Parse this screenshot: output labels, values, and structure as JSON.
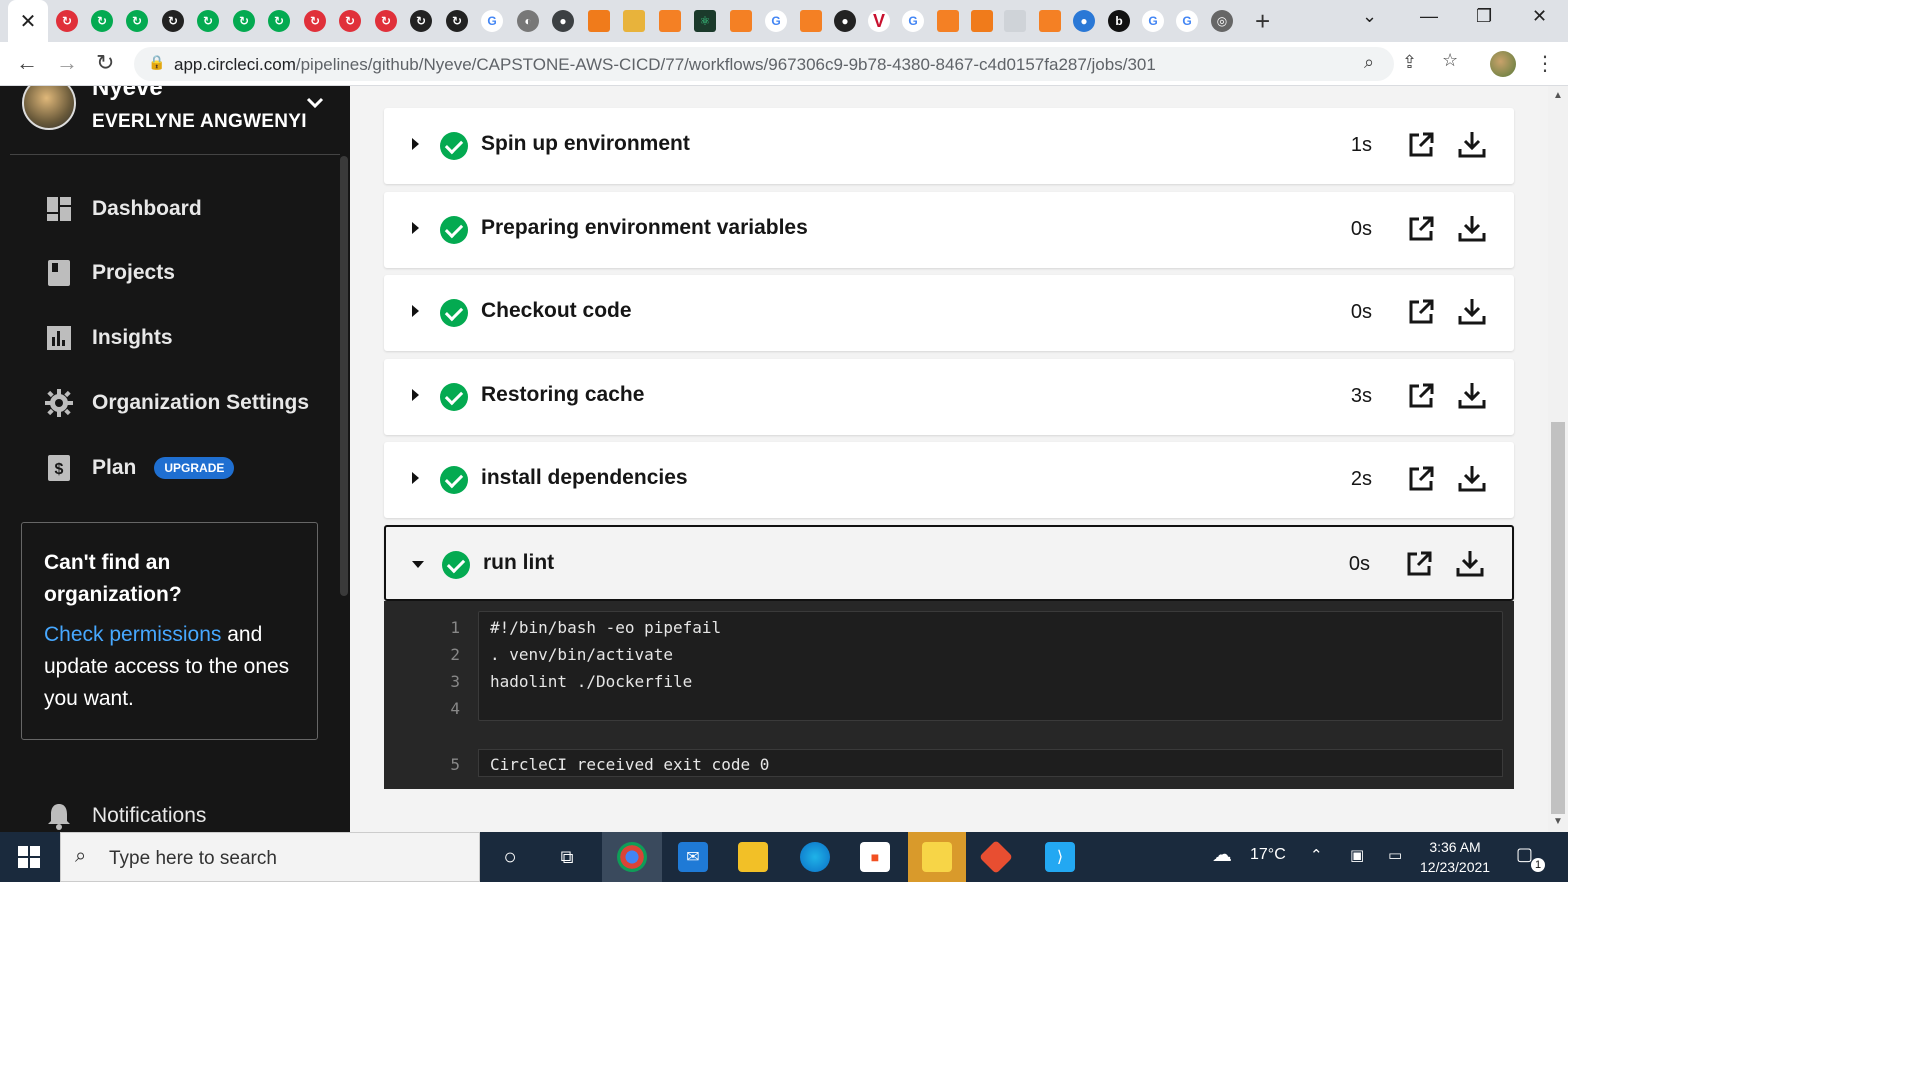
{
  "browser": {
    "url_host": "app.circleci.com",
    "url_path": "/pipelines/github/Nyeve/CAPSTONE-AWS-CICD/77/workflows/967306c9-9b78-4380-8467-c4d0157fa287/jobs/301",
    "tab_close": "✕",
    "new_tab": "+"
  },
  "sidebar": {
    "org_name": "Nyeve",
    "user_name": "EVERLYNE ANGWENYI",
    "nav": [
      {
        "label": "Dashboard",
        "icon": "dashboard-icon"
      },
      {
        "label": "Projects",
        "icon": "projects-icon"
      },
      {
        "label": "Insights",
        "icon": "insights-icon"
      },
      {
        "label": "Organization Settings",
        "icon": "gear-icon"
      },
      {
        "label": "Plan",
        "icon": "dollar-icon"
      }
    ],
    "upgrade_badge": "UPGRADE",
    "org_box": {
      "heading": "Can't find an organization?",
      "link": "Check permissions",
      "text": " and update access to the ones you want."
    },
    "notifications": "Notifications"
  },
  "steps": [
    {
      "name": "Spin up environment",
      "duration": "1s"
    },
    {
      "name": "Preparing environment variables",
      "duration": "0s"
    },
    {
      "name": "Checkout code",
      "duration": "0s"
    },
    {
      "name": "Restoring cache",
      "duration": "3s"
    },
    {
      "name": "install dependencies",
      "duration": "2s"
    },
    {
      "name": "run lint",
      "duration": "0s"
    }
  ],
  "output": {
    "lines": [
      {
        "no": "1",
        "text": "#!/bin/bash -eo pipefail"
      },
      {
        "no": "2",
        "text": ". venv/bin/activate"
      },
      {
        "no": "3",
        "text": "hadolint ./Dockerfile"
      },
      {
        "no": "4",
        "text": ""
      }
    ],
    "exit_line": {
      "no": "5",
      "text": "CircleCI received exit code 0"
    }
  },
  "taskbar": {
    "search_placeholder": "Type here to search",
    "weather": "17°C",
    "time": "3:36 AM",
    "date": "12/23/2021",
    "notification_count": "1"
  },
  "colors": {
    "success": "#04aa51",
    "sidebar_bg": "#161616",
    "link": "#47a8ff",
    "upgrade": "#1f6fd1"
  }
}
